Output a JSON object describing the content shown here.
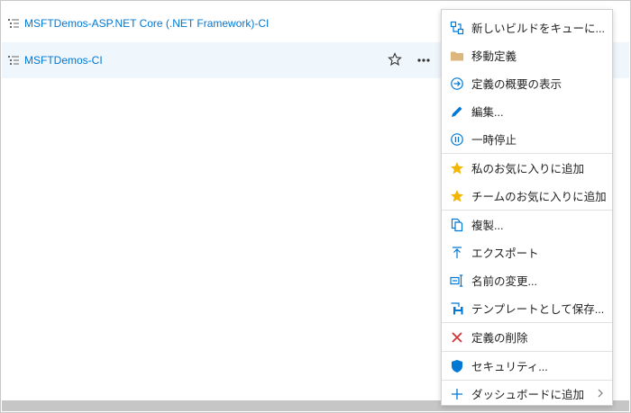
{
  "definitions": [
    {
      "name": "MSFTDemos-ASP.NET Core (.NET Framework)-CI"
    },
    {
      "name": "MSFTDemos-CI"
    }
  ],
  "context_menu": {
    "items": [
      {
        "label": "新しいビルドをキューに...",
        "icon": "queue-build-icon"
      },
      {
        "label": "移動定義",
        "icon": "folder-icon"
      },
      {
        "label": "定義の概要の表示",
        "icon": "navigate-forward-icon"
      },
      {
        "label": "編集...",
        "icon": "edit-icon"
      },
      {
        "label": "一時停止",
        "icon": "pause-icon"
      },
      {
        "label": "私のお気に入りに追加",
        "icon": "favorite-star-icon"
      },
      {
        "label": "チームのお気に入りに追加",
        "icon": "favorite-star-icon"
      },
      {
        "label": "複製...",
        "icon": "copy-icon"
      },
      {
        "label": "エクスポート",
        "icon": "export-icon"
      },
      {
        "label": "名前の変更...",
        "icon": "rename-icon"
      },
      {
        "label": "テンプレートとして保存...",
        "icon": "save-template-icon"
      },
      {
        "label": "定義の削除",
        "icon": "delete-x-icon"
      },
      {
        "label": "セキュリティ...",
        "icon": "shield-icon"
      },
      {
        "label": "ダッシュボードに追加",
        "icon": "add-icon"
      }
    ]
  },
  "colors": {
    "link": "#0078d4",
    "selected_row": "#eff6fc",
    "star": "#f2b705",
    "delete": "#d13438"
  }
}
